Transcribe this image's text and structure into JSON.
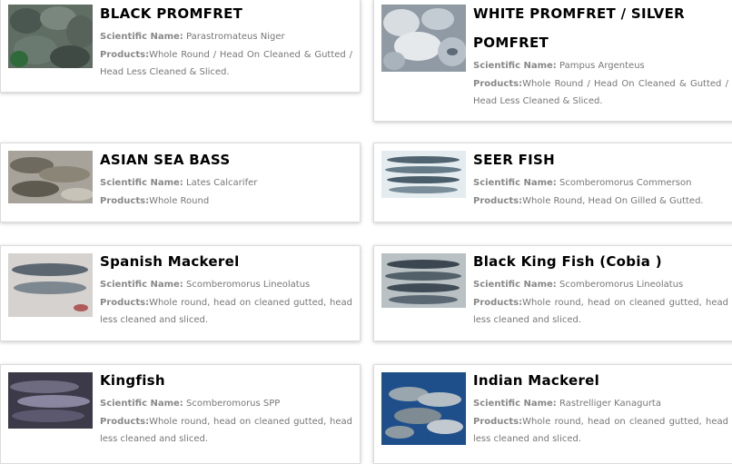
{
  "labels": {
    "scientific": "Scientific Name:",
    "products": "Products:"
  },
  "fish": [
    {
      "name": "BLACK PROMFRET",
      "scientific": "Parastromateus Niger",
      "products": "Whole Round / Head On Cleaned & Gutted / Head Less Cleaned & Sliced.",
      "image_icon": "black-pomfret-photo"
    },
    {
      "name": "WHITE PROMFRET / SILVER POMFRET",
      "scientific": "Pampus Argenteus",
      "products": "Whole Round / Head On Cleaned & Gutted / Head Less Cleaned & Sliced.",
      "image_icon": "white-pomfret-photo"
    },
    {
      "name": "ASIAN SEA BASS",
      "scientific": "Lates Calcarifer",
      "products": "Whole Round",
      "image_icon": "sea-bass-photo"
    },
    {
      "name": "SEER FISH",
      "scientific": "Scomberomorus Commerson",
      "products": "Whole Round, Head On Gilled & Gutted.",
      "image_icon": "seer-fish-photo"
    },
    {
      "name": "Spanish Mackerel",
      "scientific": "Scomberomorus Lineolatus",
      "products": "Whole round, head on cleaned gutted, head less cleaned and sliced.",
      "image_icon": "spanish-mackerel-photo"
    },
    {
      "name": "Black King Fish (Cobia )",
      "scientific": "Scomberomorus Lineolatus",
      "products": "Whole round, head on cleaned gutted, head less cleaned and sliced.",
      "image_icon": "cobia-photo"
    },
    {
      "name": "Kingfish",
      "scientific": "Scomberomorus SPP",
      "products": "Whole round, head on cleaned gutted, head less cleaned and sliced.",
      "image_icon": "kingfish-photo"
    },
    {
      "name": "Indian Mackerel",
      "scientific": "Rastrelliger Kanagurta",
      "products": "Whole round, head on cleaned gutted, head less cleaned and sliced.",
      "image_icon": "indian-mackerel-photo"
    }
  ]
}
